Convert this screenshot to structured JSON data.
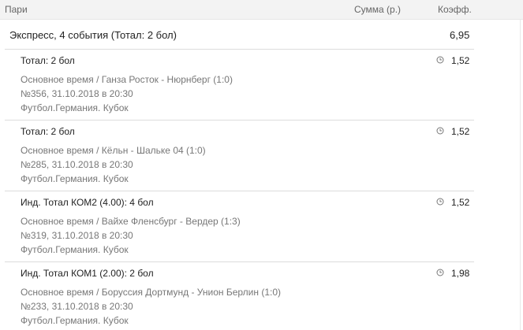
{
  "header": {
    "bets": "Пари",
    "sum": "Сумма (р.)",
    "coef": "Коэфф."
  },
  "express": {
    "title": "Экспресс, 4 события (Тотал: 2 бол)",
    "coef": "6,95"
  },
  "events": [
    {
      "market": "Тотал: 2 бол",
      "coef": "1,52",
      "match": "Основное время / Ганза Росток - Нюрнберг (1:0)",
      "info": "№356, 31.10.2018 в 20:30",
      "league": "Футбол.Германия. Кубок"
    },
    {
      "market": "Тотал: 2 бол",
      "coef": "1,52",
      "match": "Основное время / Кёльн - Шальке 04 (1:0)",
      "info": "№285, 31.10.2018 в 20:30",
      "league": "Футбол.Германия. Кубок"
    },
    {
      "market": "Инд. Тотал КОМ2 (4.00): 4 бол",
      "coef": "1,52",
      "match": "Основное время / Вайхе Фленсбург - Вердер (1:3)",
      "info": "№319, 31.10.2018 в 20:30",
      "league": "Футбол.Германия. Кубок"
    },
    {
      "market": "Инд. Тотал КОМ1 (2.00): 2 бол",
      "coef": "1,98",
      "match": "Основное время / Боруссия Дортмунд - Унион Берлин (1:0)",
      "info": "№233, 31.10.2018 в 20:30",
      "league": "Футбол.Германия. Кубок"
    }
  ],
  "icons": {
    "clock": "clock-icon"
  }
}
